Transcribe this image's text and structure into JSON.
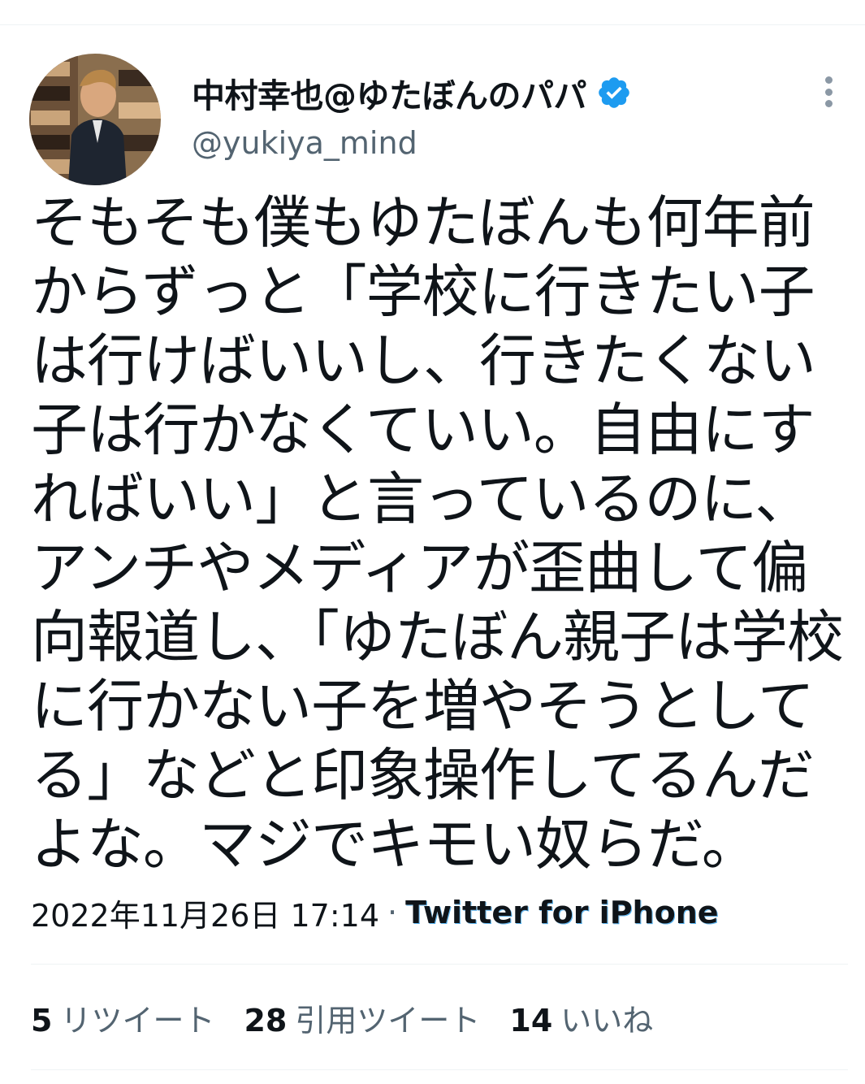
{
  "colors": {
    "text_primary": "#0f1419",
    "text_secondary": "#536471",
    "accent": "#1d9bf0",
    "divider": "#eff3f4"
  },
  "tweet": {
    "author": {
      "display_name": "中村幸也@ゆたぼんのパパ",
      "handle": "@yukiya_mind",
      "verified": true,
      "avatar_icon": "profile-photo"
    },
    "more_icon": "vertical-dots-icon",
    "text": "そもそも僕もゆたぼんも何年前からずっと「学校に行きたい子は行けばいいし、行きたくない子は行かなくていい。自由にすればいい」と言っているのに、アンチやメディアが歪曲して偏向報道し、「ゆたぼん親子は学校に行かない子を増やそうとしてる」などと印象操作してるんだよな。マジでキモい奴らだ。",
    "timestamp": "2022年11月26日 17:14",
    "separator": "·",
    "source": "Twitter for iPhone",
    "stats": {
      "retweets": {
        "count": "5",
        "label": "リツイート"
      },
      "quotes": {
        "count": "28",
        "label": "引用ツイート"
      },
      "likes": {
        "count": "14",
        "label": "いいね"
      }
    }
  }
}
